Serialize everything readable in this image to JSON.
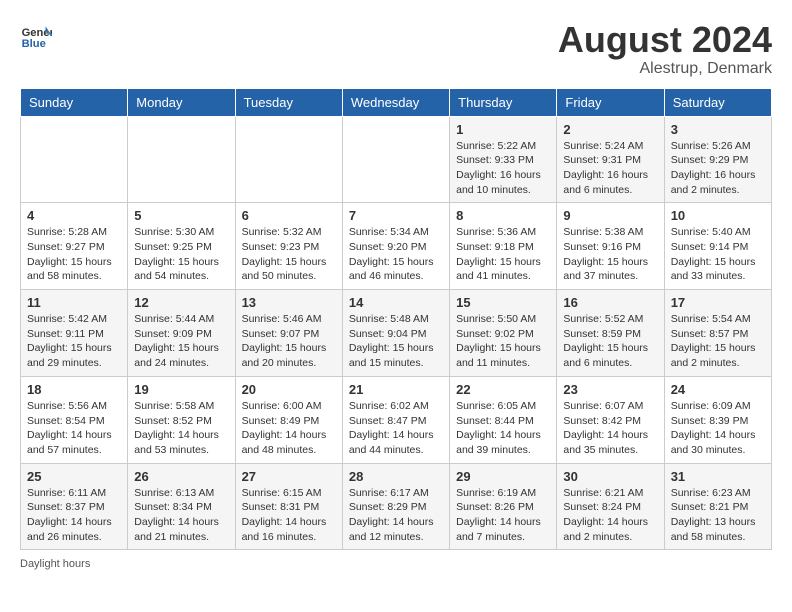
{
  "header": {
    "logo_general": "General",
    "logo_blue": "Blue",
    "month_year": "August 2024",
    "location": "Alestrup, Denmark"
  },
  "days_of_week": [
    "Sunday",
    "Monday",
    "Tuesday",
    "Wednesday",
    "Thursday",
    "Friday",
    "Saturday"
  ],
  "footer": {
    "daylight_label": "Daylight hours"
  },
  "weeks": [
    [
      {
        "day": "",
        "info": ""
      },
      {
        "day": "",
        "info": ""
      },
      {
        "day": "",
        "info": ""
      },
      {
        "day": "",
        "info": ""
      },
      {
        "day": "1",
        "sunrise": "Sunrise: 5:22 AM",
        "sunset": "Sunset: 9:33 PM",
        "daylight": "Daylight: 16 hours and 10 minutes."
      },
      {
        "day": "2",
        "sunrise": "Sunrise: 5:24 AM",
        "sunset": "Sunset: 9:31 PM",
        "daylight": "Daylight: 16 hours and 6 minutes."
      },
      {
        "day": "3",
        "sunrise": "Sunrise: 5:26 AM",
        "sunset": "Sunset: 9:29 PM",
        "daylight": "Daylight: 16 hours and 2 minutes."
      }
    ],
    [
      {
        "day": "4",
        "sunrise": "Sunrise: 5:28 AM",
        "sunset": "Sunset: 9:27 PM",
        "daylight": "Daylight: 15 hours and 58 minutes."
      },
      {
        "day": "5",
        "sunrise": "Sunrise: 5:30 AM",
        "sunset": "Sunset: 9:25 PM",
        "daylight": "Daylight: 15 hours and 54 minutes."
      },
      {
        "day": "6",
        "sunrise": "Sunrise: 5:32 AM",
        "sunset": "Sunset: 9:23 PM",
        "daylight": "Daylight: 15 hours and 50 minutes."
      },
      {
        "day": "7",
        "sunrise": "Sunrise: 5:34 AM",
        "sunset": "Sunset: 9:20 PM",
        "daylight": "Daylight: 15 hours and 46 minutes."
      },
      {
        "day": "8",
        "sunrise": "Sunrise: 5:36 AM",
        "sunset": "Sunset: 9:18 PM",
        "daylight": "Daylight: 15 hours and 41 minutes."
      },
      {
        "day": "9",
        "sunrise": "Sunrise: 5:38 AM",
        "sunset": "Sunset: 9:16 PM",
        "daylight": "Daylight: 15 hours and 37 minutes."
      },
      {
        "day": "10",
        "sunrise": "Sunrise: 5:40 AM",
        "sunset": "Sunset: 9:14 PM",
        "daylight": "Daylight: 15 hours and 33 minutes."
      }
    ],
    [
      {
        "day": "11",
        "sunrise": "Sunrise: 5:42 AM",
        "sunset": "Sunset: 9:11 PM",
        "daylight": "Daylight: 15 hours and 29 minutes."
      },
      {
        "day": "12",
        "sunrise": "Sunrise: 5:44 AM",
        "sunset": "Sunset: 9:09 PM",
        "daylight": "Daylight: 15 hours and 24 minutes."
      },
      {
        "day": "13",
        "sunrise": "Sunrise: 5:46 AM",
        "sunset": "Sunset: 9:07 PM",
        "daylight": "Daylight: 15 hours and 20 minutes."
      },
      {
        "day": "14",
        "sunrise": "Sunrise: 5:48 AM",
        "sunset": "Sunset: 9:04 PM",
        "daylight": "Daylight: 15 hours and 15 minutes."
      },
      {
        "day": "15",
        "sunrise": "Sunrise: 5:50 AM",
        "sunset": "Sunset: 9:02 PM",
        "daylight": "Daylight: 15 hours and 11 minutes."
      },
      {
        "day": "16",
        "sunrise": "Sunrise: 5:52 AM",
        "sunset": "Sunset: 8:59 PM",
        "daylight": "Daylight: 15 hours and 6 minutes."
      },
      {
        "day": "17",
        "sunrise": "Sunrise: 5:54 AM",
        "sunset": "Sunset: 8:57 PM",
        "daylight": "Daylight: 15 hours and 2 minutes."
      }
    ],
    [
      {
        "day": "18",
        "sunrise": "Sunrise: 5:56 AM",
        "sunset": "Sunset: 8:54 PM",
        "daylight": "Daylight: 14 hours and 57 minutes."
      },
      {
        "day": "19",
        "sunrise": "Sunrise: 5:58 AM",
        "sunset": "Sunset: 8:52 PM",
        "daylight": "Daylight: 14 hours and 53 minutes."
      },
      {
        "day": "20",
        "sunrise": "Sunrise: 6:00 AM",
        "sunset": "Sunset: 8:49 PM",
        "daylight": "Daylight: 14 hours and 48 minutes."
      },
      {
        "day": "21",
        "sunrise": "Sunrise: 6:02 AM",
        "sunset": "Sunset: 8:47 PM",
        "daylight": "Daylight: 14 hours and 44 minutes."
      },
      {
        "day": "22",
        "sunrise": "Sunrise: 6:05 AM",
        "sunset": "Sunset: 8:44 PM",
        "daylight": "Daylight: 14 hours and 39 minutes."
      },
      {
        "day": "23",
        "sunrise": "Sunrise: 6:07 AM",
        "sunset": "Sunset: 8:42 PM",
        "daylight": "Daylight: 14 hours and 35 minutes."
      },
      {
        "day": "24",
        "sunrise": "Sunrise: 6:09 AM",
        "sunset": "Sunset: 8:39 PM",
        "daylight": "Daylight: 14 hours and 30 minutes."
      }
    ],
    [
      {
        "day": "25",
        "sunrise": "Sunrise: 6:11 AM",
        "sunset": "Sunset: 8:37 PM",
        "daylight": "Daylight: 14 hours and 26 minutes."
      },
      {
        "day": "26",
        "sunrise": "Sunrise: 6:13 AM",
        "sunset": "Sunset: 8:34 PM",
        "daylight": "Daylight: 14 hours and 21 minutes."
      },
      {
        "day": "27",
        "sunrise": "Sunrise: 6:15 AM",
        "sunset": "Sunset: 8:31 PM",
        "daylight": "Daylight: 14 hours and 16 minutes."
      },
      {
        "day": "28",
        "sunrise": "Sunrise: 6:17 AM",
        "sunset": "Sunset: 8:29 PM",
        "daylight": "Daylight: 14 hours and 12 minutes."
      },
      {
        "day": "29",
        "sunrise": "Sunrise: 6:19 AM",
        "sunset": "Sunset: 8:26 PM",
        "daylight": "Daylight: 14 hours and 7 minutes."
      },
      {
        "day": "30",
        "sunrise": "Sunrise: 6:21 AM",
        "sunset": "Sunset: 8:24 PM",
        "daylight": "Daylight: 14 hours and 2 minutes."
      },
      {
        "day": "31",
        "sunrise": "Sunrise: 6:23 AM",
        "sunset": "Sunset: 8:21 PM",
        "daylight": "Daylight: 13 hours and 58 minutes."
      }
    ]
  ]
}
